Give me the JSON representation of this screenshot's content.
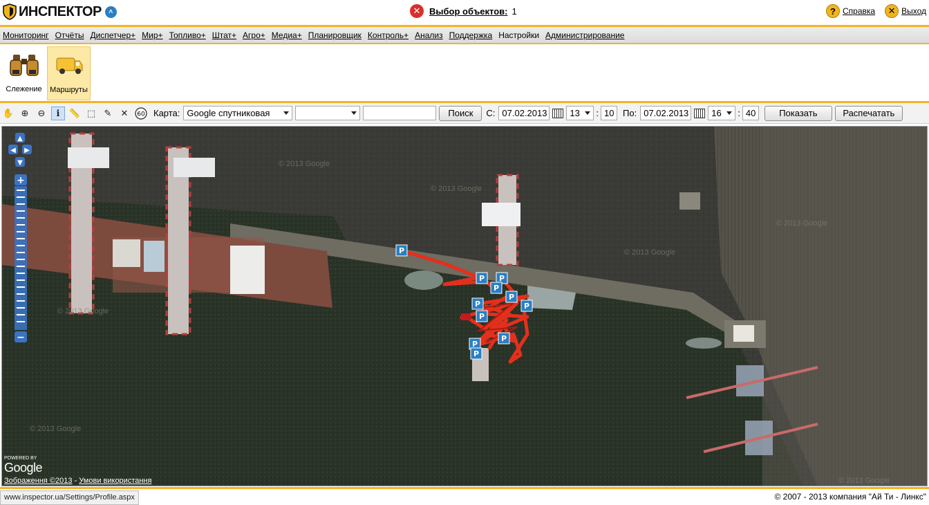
{
  "header": {
    "app_name": "ИНСПЕКТОР",
    "selection_label": "Выбор объектов:",
    "selection_count": "1",
    "help_label": "Справка",
    "exit_label": "Выход"
  },
  "menu": {
    "items": [
      {
        "label": "Мониторинг"
      },
      {
        "label": "Отчёты"
      },
      {
        "label": "Диспетчер+"
      },
      {
        "label": "Мир+"
      },
      {
        "label": "Топливо+"
      },
      {
        "label": "Штат+"
      },
      {
        "label": "Агро+"
      },
      {
        "label": "Медиа+"
      },
      {
        "label": "Планировщик"
      },
      {
        "label": "Контроль+"
      },
      {
        "label": "Анализ"
      },
      {
        "label": "Поддержка"
      },
      {
        "label": "Настройки"
      },
      {
        "label": "Администрирование"
      }
    ],
    "active_index": 12
  },
  "ribbon": {
    "tracking_label": "Слежение",
    "routes_label": "Маршруты"
  },
  "toolbar": {
    "map_label": "Карта:",
    "map_type": "Google спутниковая",
    "layer_value": "",
    "search_value": "",
    "search_button": "Поиск",
    "from_label": "С:",
    "from_date": "07.02.2013",
    "from_hour": "13",
    "from_minute": "10",
    "to_label": "По:",
    "to_date": "07.02.2013",
    "to_hour": "16",
    "to_minute": "40",
    "show_button": "Показать",
    "print_button": "Распечатать",
    "speed_badge": "60"
  },
  "map": {
    "powered_by": "POWERED BY",
    "google": "Google",
    "imagery": "Зображення ©2013",
    "separator": " - ",
    "terms": "Умови використання",
    "watermark": "© 2013 Google",
    "parking_letter": "P",
    "pan_up": "▲",
    "pan_left": "◀",
    "pan_right": "▶",
    "pan_down": "▼",
    "zoom_in": "+",
    "zoom_out": "−"
  },
  "status_url": "www.inspector.ua/Settings/Profile.aspx",
  "copyright": "© 2007 - 2013 компания \"Ай Ти - Линкс\""
}
